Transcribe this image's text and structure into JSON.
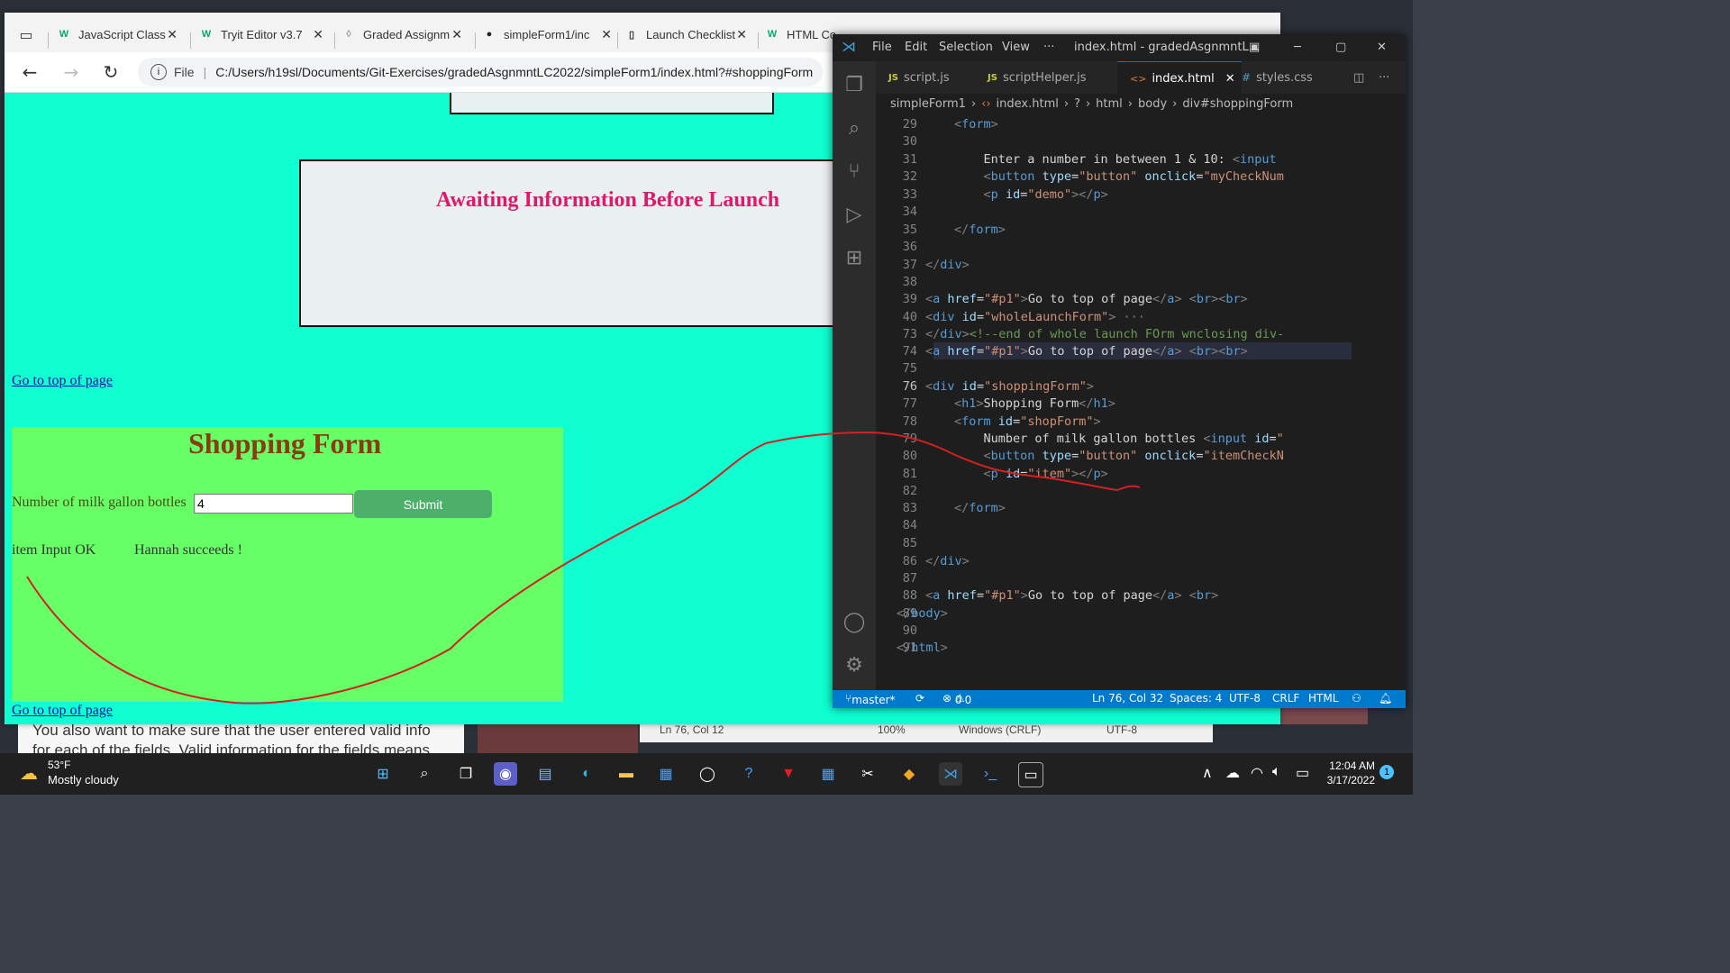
{
  "browser": {
    "tabs": [
      {
        "label": "JavaScript Class",
        "icon": "w3schools-icon"
      },
      {
        "label": "Tryit Editor v3.7",
        "icon": "w3schools-icon"
      },
      {
        "label": "Graded Assignm",
        "icon": "bulb-icon"
      },
      {
        "label": "simpleForm1/inc",
        "icon": "github-icon"
      },
      {
        "label": "Launch Checklist",
        "icon": "file-icon"
      },
      {
        "label": "HTML Co",
        "icon": "w3schools-icon"
      }
    ],
    "address": {
      "scheme_label": "File",
      "url": "C:/Users/h19sl/Documents/Git-Exercises/gradedAsgnmntLC2022/simpleForm1/index.html?#shoppingForm"
    }
  },
  "page": {
    "launch_title": "Awaiting Information Before Launch",
    "top_link": "Go to top of page",
    "shopping": {
      "title": "Shopping Form",
      "label": "Number of milk gallon bottles",
      "input_value": "4",
      "submit_label": "Submit",
      "message1": "item Input OK",
      "message2": "Hannah succeeds !"
    }
  },
  "vscode": {
    "menu": [
      "File",
      "Edit",
      "Selection",
      "View",
      "···"
    ],
    "window_title": "index.html - gradedAsgnmntL...",
    "tabs": [
      {
        "label": "script.js",
        "icon": "JS"
      },
      {
        "label": "scriptHelper.js",
        "icon": "JS"
      },
      {
        "label": "index.html",
        "icon": "<>"
      },
      {
        "label": "styles.css",
        "icon": "#"
      }
    ],
    "breadcrumbs": [
      "simpleForm1",
      "index.html",
      "?",
      "html",
      "body",
      "div#shoppingForm"
    ],
    "lines": [
      "29",
      "30",
      "31",
      "32",
      "33",
      "34",
      "35",
      "36",
      "37",
      "38",
      "39",
      "40",
      "73",
      "74",
      "75",
      "76",
      "77",
      "78",
      "79",
      "80",
      "81",
      "82",
      "83",
      "84",
      "85",
      "86",
      "87",
      "88",
      "89",
      "90",
      "91"
    ],
    "status": {
      "branch": "master*",
      "problems": "0",
      "warnings": "0",
      "position": "Ln 76, Col 32",
      "spaces": "Spaces: 4",
      "encoding": "UTF-8",
      "eol": "CRLF",
      "language": "HTML"
    }
  },
  "background": {
    "doc_text_1": "You also want to make sure that the user entered valid info",
    "doc_text_2": "for each of the fields. Valid information for the fields means",
    "notepad_pos": "Ln 76, Col 12",
    "notepad_zoom": "100%",
    "notepad_eol": "Windows (CRLF)",
    "notepad_enc": "UTF-8"
  },
  "taskbar": {
    "temperature": "53°F",
    "weather": "Mostly cloudy",
    "time": "12:04 AM",
    "date": "3/17/2022",
    "notification_count": "1"
  }
}
